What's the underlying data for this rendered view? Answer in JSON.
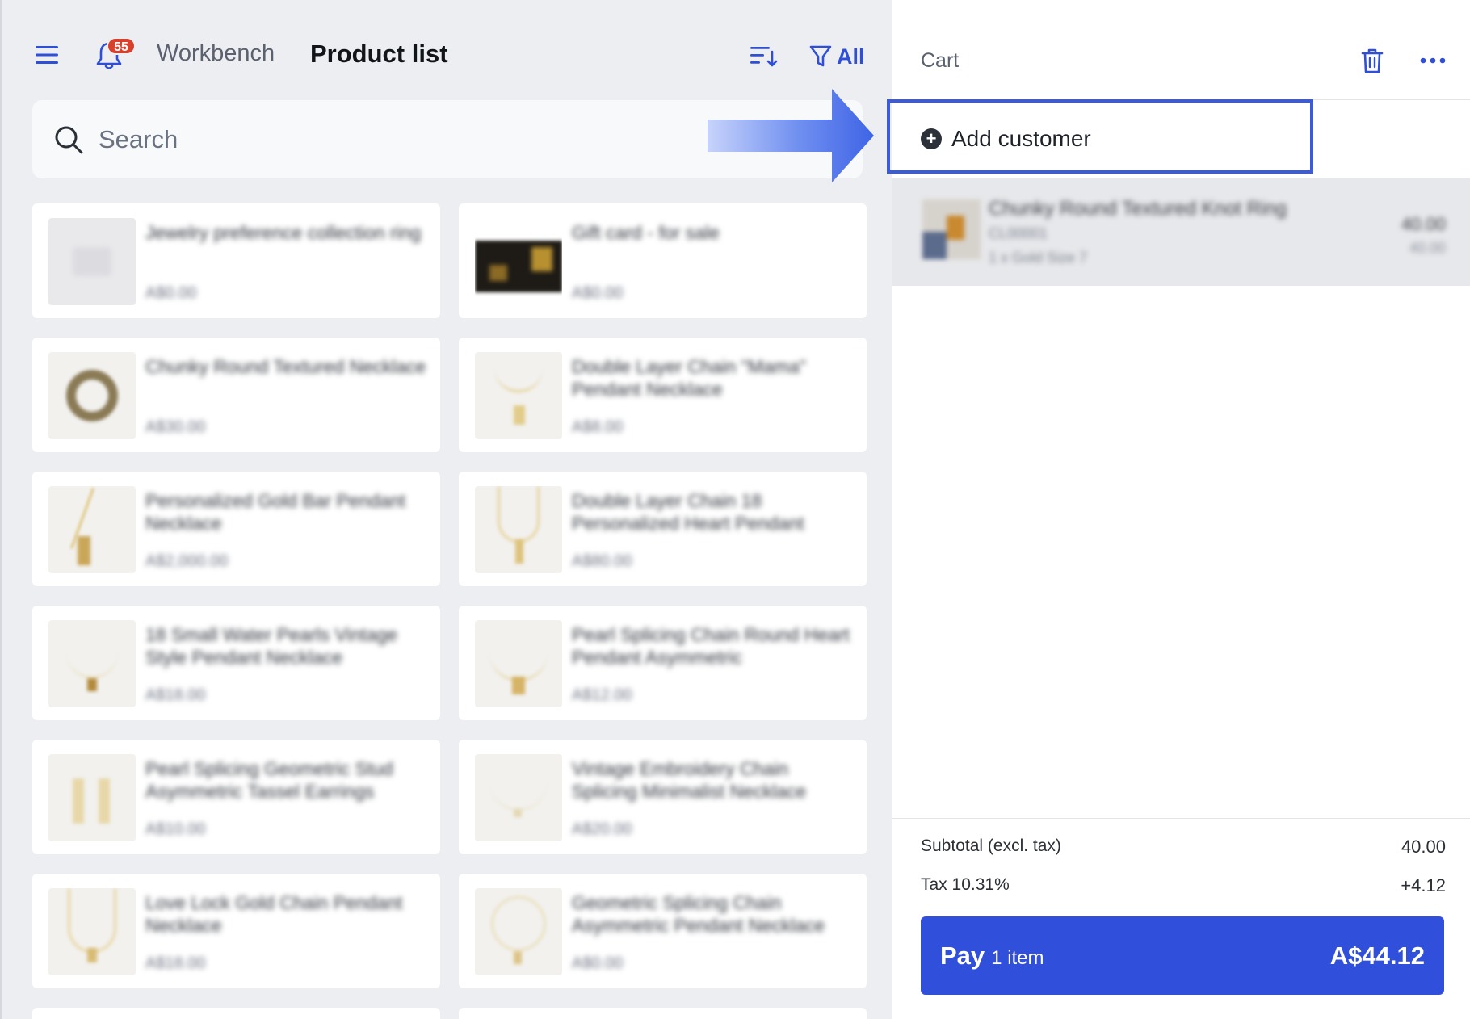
{
  "topbar": {
    "notifications_count": "55",
    "workbench_label": "Workbench",
    "page_title": "Product list",
    "filter_label": "All"
  },
  "search": {
    "placeholder": "Search"
  },
  "products": [
    {
      "name": "Jewelry preference collection ring",
      "price": "A$0.00"
    },
    {
      "name": "Gift card - for sale",
      "price": "A$0.00"
    },
    {
      "name": "Chunky Round Textured Necklace",
      "price": "A$30.00"
    },
    {
      "name": "Double Layer Chain \"Mama\" Pendant Necklace",
      "price": "A$8.00"
    },
    {
      "name": "Personalized Gold Bar Pendant Necklace",
      "price": "A$2,000.00"
    },
    {
      "name": "Double Layer Chain 18 Personalized Heart Pendant",
      "price": "A$80.00"
    },
    {
      "name": "18 Small Water Pearls Vintage Style Pendant Necklace",
      "price": "A$18.00"
    },
    {
      "name": "Pearl Splicing Chain Round Heart Pendant Asymmetric",
      "price": "A$12.00"
    },
    {
      "name": "Pearl Splicing Geometric Stud Asymmetric Tassel Earrings",
      "price": "A$10.00"
    },
    {
      "name": "Vintage Embroidery Chain Splicing Minimalist Necklace",
      "price": "A$20.00"
    },
    {
      "name": "Love Lock Gold Chain Pendant Necklace",
      "price": "A$18.00"
    },
    {
      "name": "Geometric Splicing Chain Asymmetric Pendant Necklace",
      "price": "A$0.00"
    }
  ],
  "cart": {
    "title": "Cart",
    "add_customer_label": "Add customer",
    "item": {
      "name": "Chunky Round Textured Knot Ring",
      "sku": "CL00001",
      "detail": "1 x Gold Size 7",
      "price": "40.00",
      "unit": "40.00"
    },
    "subtotal_label": "Subtotal (excl. tax)",
    "subtotal_value": "40.00",
    "tax_label": "Tax 10.31%",
    "tax_value": "+4.12",
    "pay_label": "Pay",
    "pay_count": "1 item",
    "pay_total": "A$44.12"
  },
  "colors": {
    "accent": "#3050dc",
    "badge": "#d9402b",
    "highlight": "#3a5bdc"
  },
  "icons": [
    "menu-icon",
    "bell-icon",
    "sort-icon",
    "filter-icon",
    "search-icon",
    "trash-icon",
    "more-icon",
    "plus-circle-icon"
  ]
}
